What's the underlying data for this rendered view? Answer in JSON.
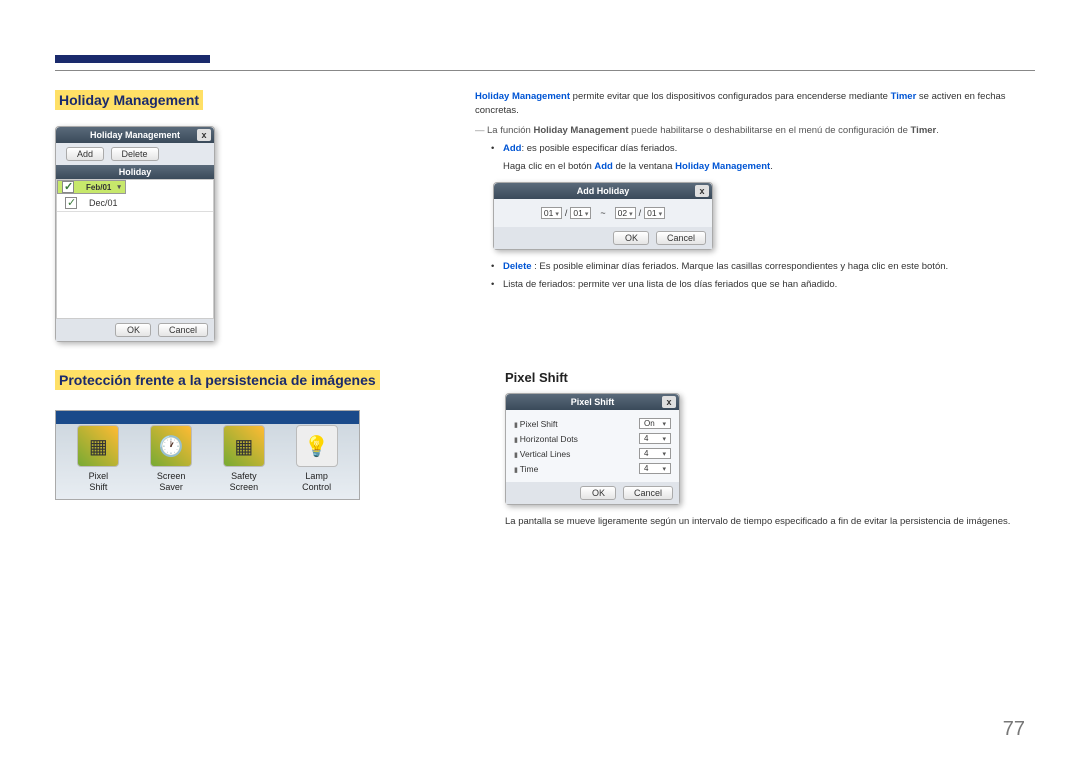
{
  "page_number": "77",
  "section1_title": "Holiday Management",
  "hm_dialog": {
    "title": "Holiday Management",
    "add_btn": "Add",
    "delete_btn": "Delete",
    "col_header": "Holiday",
    "rows": [
      "Feb/01",
      "Dec/01"
    ],
    "ok": "OK",
    "cancel": "Cancel"
  },
  "rtext": {
    "p1a": "Holiday Management",
    "p1b": " permite evitar que los dispositivos configurados para encenderse mediante ",
    "p1c": "Timer",
    "p1d": " se activen en fechas concretas.",
    "note_a": "La función ",
    "note_b": "Holiday Management",
    "note_c": " puede habilitarse o deshabilitarse en el menú de configuración de ",
    "note_d": "Timer",
    "note_e": ".",
    "add_a": "Add",
    "add_b": ": es posible especificar días feriados.",
    "add_line_a": "Haga clic en el botón ",
    "add_line_b": "Add",
    "add_line_c": " de la ventana ",
    "add_line_d": "Holiday Management",
    "add_line_e": ".",
    "delete_a": "Delete",
    "delete_b": " : Es posible eliminar días feriados. Marque las casillas correspondientes y haga clic en este botón.",
    "list_line": "Lista de feriados: permite ver una lista de los días feriados que se han añadido."
  },
  "addh": {
    "title": "Add Holiday",
    "m1": "01",
    "d1": "01",
    "m2": "02",
    "d2": "01",
    "ok": "OK",
    "cancel": "Cancel"
  },
  "section2_title": "Protección frente a la persistencia de imágenes",
  "iconbar": {
    "i1a": "Pixel",
    "i1b": "Shift",
    "i2a": "Screen",
    "i2b": "Saver",
    "i3a": "Safety",
    "i3b": "Screen",
    "i4a": "Lamp",
    "i4b": "Control"
  },
  "pixel_shift_hdr": "Pixel Shift",
  "ps": {
    "title": "Pixel Shift",
    "r1": "Pixel Shift",
    "v1": "On",
    "r2": "Horizontal Dots",
    "v2": "4",
    "r3": "Vertical Lines",
    "v3": "4",
    "r4": "Time",
    "v4": "4",
    "ok": "OK",
    "cancel": "Cancel"
  },
  "ps_desc": "La pantalla se mueve ligeramente según un intervalo de tiempo especificado a fin de evitar la persistencia de imágenes."
}
